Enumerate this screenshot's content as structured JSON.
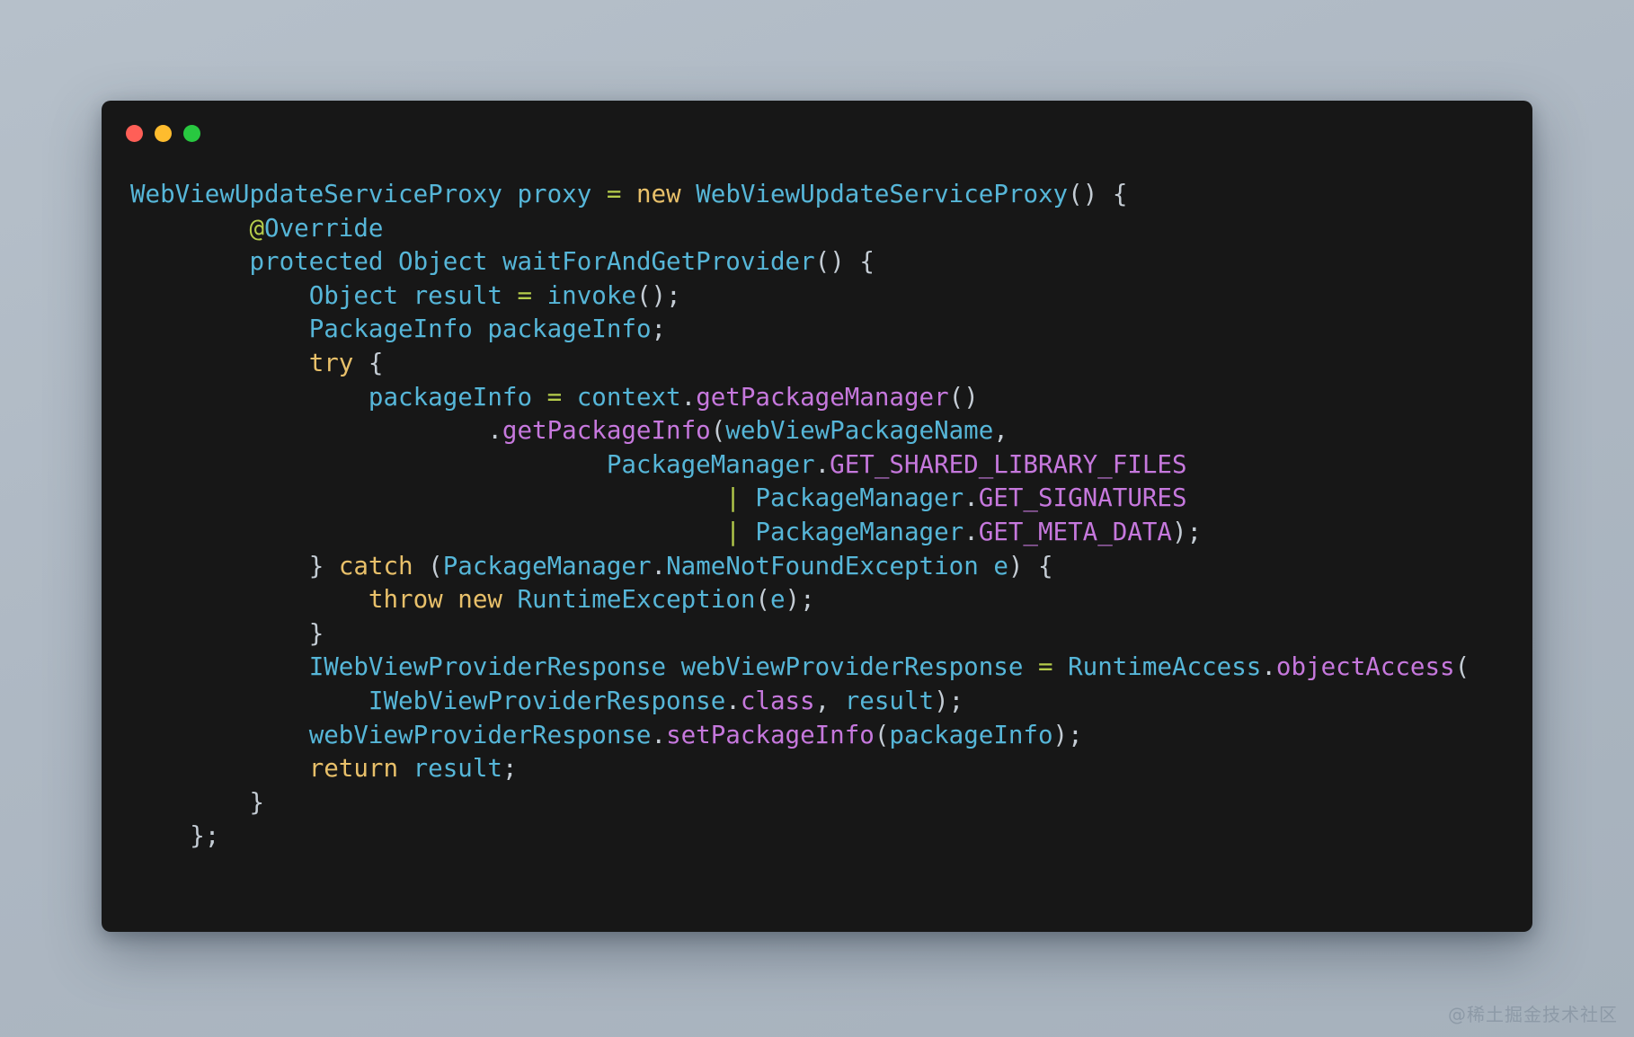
{
  "window": {
    "traffic_lights": [
      {
        "name": "close",
        "color": "#ff5f57"
      },
      {
        "name": "minimize",
        "color": "#febc2e"
      },
      {
        "name": "maximize",
        "color": "#28c840"
      }
    ],
    "background_color": "#171717"
  },
  "theme": {
    "page_background_top": "#b6c0ca",
    "page_background_bottom": "#a6b1bc",
    "identifier_color": "#56b6d8",
    "keyword_color": "#e8c06a",
    "function_color": "#c678dd",
    "operator_color": "#b5cc4b",
    "punctuation_color": "#c4ccd4"
  },
  "code": {
    "language": "java",
    "plain_text": "WebViewUpdateServiceProxy proxy = new WebViewUpdateServiceProxy() {\n        @Override\n        protected Object waitForAndGetProvider() {\n            Object result = invoke();\n            PackageInfo packageInfo;\n            try {\n                packageInfo = context.getPackageManager()\n                        .getPackageInfo(webViewPackageName,\n                                PackageManager.GET_SHARED_LIBRARY_FILES\n                                        | PackageManager.GET_SIGNATURES\n                                        | PackageManager.GET_META_DATA);\n            } catch (PackageManager.NameNotFoundException e) {\n                throw new RuntimeException(e);\n            }\n            IWebViewProviderResponse webViewProviderResponse = RuntimeAccess.objectAccess(\n                IWebViewProviderResponse.class, result);\n            webViewProviderResponse.setPackageInfo(packageInfo);\n            return result;\n        }\n    };",
    "lines": [
      {
        "n": 1,
        "text": "WebViewUpdateServiceProxy proxy = new WebViewUpdateServiceProxy() {"
      },
      {
        "n": 2,
        "text": "        @Override"
      },
      {
        "n": 3,
        "text": "        protected Object waitForAndGetProvider() {"
      },
      {
        "n": 4,
        "text": "            Object result = invoke();"
      },
      {
        "n": 5,
        "text": "            PackageInfo packageInfo;"
      },
      {
        "n": 6,
        "text": "            try {"
      },
      {
        "n": 7,
        "text": "                packageInfo = context.getPackageManager()"
      },
      {
        "n": 8,
        "text": "                        .getPackageInfo(webViewPackageName,"
      },
      {
        "n": 9,
        "text": "                                PackageManager.GET_SHARED_LIBRARY_FILES"
      },
      {
        "n": 10,
        "text": "                                        | PackageManager.GET_SIGNATURES"
      },
      {
        "n": 11,
        "text": "                                        | PackageManager.GET_META_DATA);"
      },
      {
        "n": 12,
        "text": "            } catch (PackageManager.NameNotFoundException e) {"
      },
      {
        "n": 13,
        "text": "                throw new RuntimeException(e);"
      },
      {
        "n": 14,
        "text": "            }"
      },
      {
        "n": 15,
        "text": "            IWebViewProviderResponse webViewProviderResponse = RuntimeAccess.objectAccess("
      },
      {
        "n": 16,
        "text": "                IWebViewProviderResponse.class, result);"
      },
      {
        "n": 17,
        "text": "            webViewProviderResponse.setPackageInfo(packageInfo);"
      },
      {
        "n": 18,
        "text": "            return result;"
      },
      {
        "n": 19,
        "text": "        }"
      },
      {
        "n": 20,
        "text": "    };"
      }
    ]
  },
  "watermark": {
    "text": "@稀土掘金技术社区"
  }
}
